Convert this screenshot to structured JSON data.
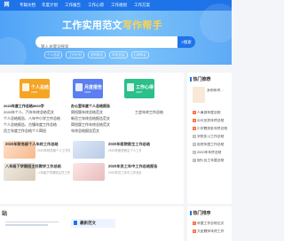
{
  "nav": {
    "logo": "网",
    "items": [
      "专辑文档",
      "年度计划",
      "工作报告",
      "工作心得",
      "工作规划",
      "工作方案"
    ]
  },
  "hero": {
    "title_main": "工作实用范文",
    "title_accent": "写作帮手",
    "search_placeholder": "输入关键词搜索",
    "search_button": "搜索",
    "tags": [
      "个人总结",
      "工作计划",
      "述职报告",
      "年终总结",
      "心得体会"
    ]
  },
  "cards": [
    {
      "label": "个人总结",
      "sub": "more",
      "color": "#f5a524"
    },
    {
      "label": "月度报告",
      "sub": "more",
      "color": "#5b7ff2"
    },
    {
      "label": "工作心得",
      "sub": "more",
      "color": "#2bbf8a"
    }
  ],
  "links": {
    "col1": [
      {
        "text": "2020年度工作总结8000字",
        "hot": true
      },
      {
        "text": "2020年个人、汽车年终总结范文",
        "hot": false
      },
      {
        "text": "个人总结报告、八年中小学工作总结",
        "hot": false
      },
      {
        "text": "个人总结报告、古镇年度工作总结",
        "hot": false
      },
      {
        "text": "员工年度工作总结个人简短",
        "hot": false
      }
    ],
    "col2": [
      {
        "text": "办公室年度个人总结报告",
        "hot": true
      },
      {
        "text": "简短版年终总结范文",
        "hot": false
      },
      {
        "text": "新员工年终总结报告范文",
        "hot": false
      },
      {
        "text": "简短版工作年终总结范文",
        "hot": false
      },
      {
        "text": "年终总结报告范文",
        "hot": false
      }
    ],
    "col3": [
      {
        "text": "",
        "hot": false
      },
      {
        "text": "工会年终工作总结",
        "hot": false
      },
      {
        "text": "",
        "hot": false
      },
      {
        "text": "",
        "hot": false
      },
      {
        "text": "",
        "hot": false
      }
    ]
  },
  "recommend": [
    {
      "title": "2020年财务部个人年终工作总结",
      "sub": "2020年财务部个人工作总结范文，对于..."
    },
    {
      "title": "2020年医院医生工作总结",
      "sub": "2020年医院医生个人工作总结，一年以..."
    },
    {
      "title": "八年级下学期班主任教学工作总结",
      "sub": "八年级下学期班主任工作总结..."
    },
    {
      "title": "2020年员工年中工作总结报告",
      "sub": "2020年员工年中工作总结报告范文..."
    }
  ],
  "sidebar": {
    "hot_title": "热门推荐",
    "hot_items": [
      "多例年终…",
      "人事部年度总结",
      "公司业务年终总结",
      "小学教务处年终总结",
      "学校实习工作总结",
      "医院年度工作总结",
      "2020年年终总结",
      "银行员工年度总结"
    ],
    "rank_title": "热门排序",
    "rank_items": [
      "年度工作总结范文",
      "大班教师年终工作"
    ]
  },
  "bottom": {
    "left_title": "站",
    "tab": "最新范文"
  },
  "colors": {
    "accent": "#1f73e8",
    "highlight": "#ffd34d"
  }
}
